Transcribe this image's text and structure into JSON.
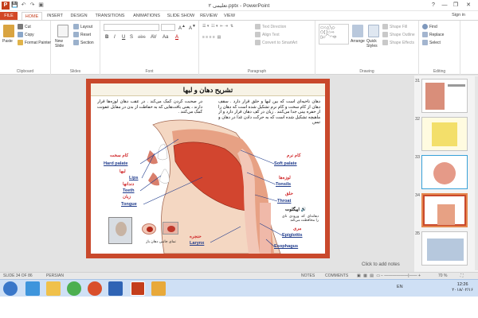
{
  "window": {
    "title": "تعلیمی ۲.pptx - PowerPoint",
    "controls": [
      "?",
      "—",
      "❐",
      "✕"
    ],
    "app_badge": "P"
  },
  "quick_access": [
    "💾",
    "↶",
    "↷",
    "▣"
  ],
  "tabs": [
    "FILE",
    "HOME",
    "INSERT",
    "DESIGN",
    "TRANSITIONS",
    "ANIMATIONS",
    "SLIDE SHOW",
    "REVIEW",
    "VIEW"
  ],
  "sign_in": "Sign in",
  "ribbon": {
    "clipboard": {
      "label": "Clipboard",
      "paste": "Paste",
      "cut": "Cut",
      "copy": "Copy",
      "format_painter": "Format Painter"
    },
    "slides": {
      "label": "Slides",
      "new_slide": "New Slide",
      "layout": "Layout",
      "reset": "Reset",
      "section": "Section"
    },
    "font": {
      "label": "Font",
      "buttons": [
        "B",
        "I",
        "U",
        "S",
        "abc",
        "AV",
        "Aa",
        "A"
      ]
    },
    "paragraph": {
      "label": "Paragraph",
      "text_direction": "Text Direction",
      "align_text": "Align Text",
      "convert_smartart": "Convert to SmartArt"
    },
    "drawing": {
      "label": "Drawing",
      "arrange": "Arrange",
      "quick_styles": "Quick Styles",
      "shape_fill": "Shape Fill",
      "shape_outline": "Shape Outline",
      "shape_effects": "Shape Effects"
    },
    "editing": {
      "label": "Editing",
      "find": "Find",
      "replace": "Replace",
      "select": "Select"
    }
  },
  "slide": {
    "title": "تشریح دهان و لبها",
    "para_right": "دهان ناحیه‌ای است که بین لبها و حلق قرار دارد . سقف دهان از کام سخت و کام نرم تشکیل شده است که دهان را از حفره بینی جدا می‌کنند . زبان در کف دهان قرار دارد و از ماهیچه تشکیل شده است که به حرکت دادن غذا در دهان و تبس",
    "para_left": "در صحبت کردن کمک می‌کند . در عقب دهان لوزه‌ها قرار دارند ، یعنی بافت‌هایی که به حفاظت از بدن در مقابل عفونت کمک می‌کنند .",
    "labels_left": [
      {
        "fa": "کام سخت",
        "en": "Hard palate"
      },
      {
        "fa": "لبها",
        "en": "Lips"
      },
      {
        "fa": "دندانها",
        "en": "Teeth"
      },
      {
        "fa": "زبان",
        "en": "Tongue"
      }
    ],
    "labels_right": [
      {
        "fa": "کام نرم",
        "en": "Soft palate"
      },
      {
        "fa": "لوزه‌ها",
        "en": "Tonsils"
      },
      {
        "fa": "حلق",
        "en": "Throat"
      },
      {
        "fa": "مری",
        "en": "Epiglottis"
      }
    ],
    "epiglottis_fa": "اپیگلوت",
    "epiglottis_desc": "دهانه‌ای که ورودی نای را محافظت می‌کند",
    "esophagus_en": "Esophagus",
    "larynx_fa": "حنجره",
    "larynx_en": "Larynx",
    "caption": "نمای جانبی دهان باز"
  },
  "click_to_add_notes": "Click to add notes",
  "thumbnails": [
    {
      "num": "31",
      "selected": false
    },
    {
      "num": "32",
      "selected": false
    },
    {
      "num": "33",
      "selected": false
    },
    {
      "num": "34",
      "selected": true
    },
    {
      "num": "35",
      "selected": false
    }
  ],
  "status": {
    "slide_info": "SLIDE 34 OF 86",
    "language": "PERSIAN",
    "notes": "NOTES",
    "comments": "COMMENTS",
    "zoom": "70 %"
  },
  "taskbar": {
    "lang": "EN",
    "time": "12:26",
    "date": "۲۰۱۸/۰۲/۱۶"
  }
}
